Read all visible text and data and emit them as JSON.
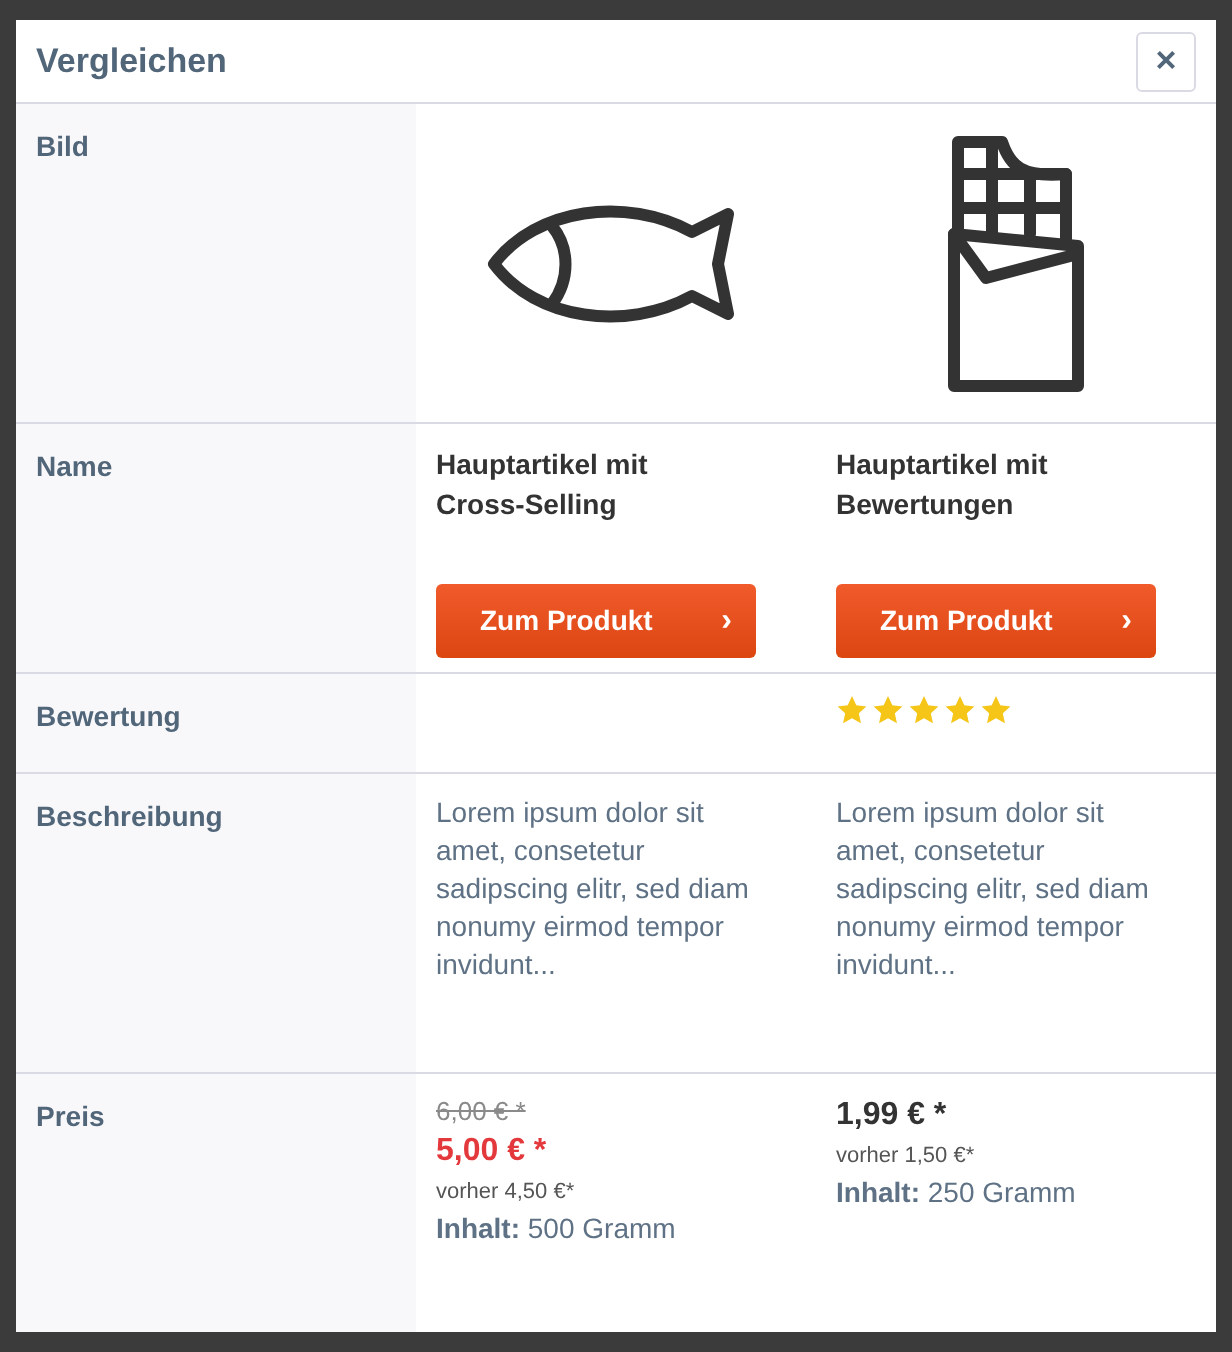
{
  "dialog": {
    "title": "Vergleichen",
    "close": "×"
  },
  "row_labels": [
    "Bild",
    "Name",
    "Bewertung",
    "Beschreibung",
    "Preis"
  ],
  "products": [
    {
      "image": {
        "kind": "fish"
      },
      "name": "Hauptartikel mit Cross-Selling",
      "button": "Zum Produkt",
      "button_arrow": "›",
      "description": "Lorem ipsum dolor sit amet, consetetur sadipscing elitr, sed diam nonumy eirmod tempor invidunt...",
      "pseudo_price": "6,00 € *",
      "price": "5,00 € *",
      "discounted": true,
      "reference": "vorher 4,50 €*",
      "content_label": "Inhalt:",
      "content": "500 Gramm"
    },
    {
      "image": {
        "kind": "chocolate"
      },
      "name": "Hauptartikel mit Bewertungen",
      "button": "Zum Produkt",
      "button_arrow": "›",
      "stars": 5,
      "description": "Lorem ipsum dolor sit amet, consetetur sadipscing elitr, sed diam nonumy eirmod tempor invidunt...",
      "price": "1,99 € *",
      "discounted": false,
      "reference": "vorher 1,50 €*",
      "content_label": "Inhalt:",
      "content": "250 Gramm"
    }
  ]
}
